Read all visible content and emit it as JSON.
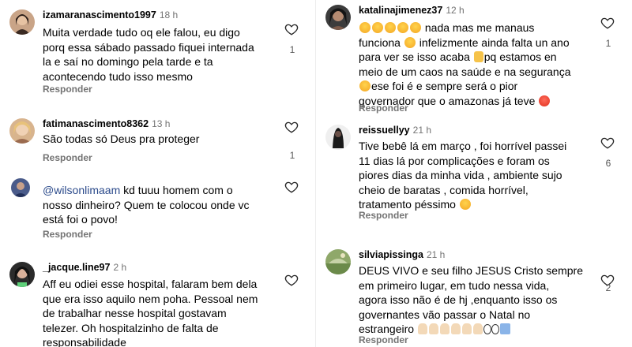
{
  "reply_label": "Responder",
  "left": {
    "c1": {
      "username": "izamaranascimento1997",
      "time": "18 h",
      "lines": [
        "Muita verdade tudo oq ele falou, eu digo",
        "porq essa sábado passado fiquei internada",
        "la e saí no domingo pela tarde e ta",
        "acontecendo tudo isso mesmo"
      ],
      "likes": "1"
    },
    "c2": {
      "username": "fatimanascimento8362",
      "time": "13 h",
      "lines": [
        "São todas só Deus pra proteger"
      ],
      "likes": "1"
    },
    "c3": {
      "mention": "@wilsonlimaam",
      "first_rest": " kd tuuu homem com o",
      "lines": [
        "nosso dinheiro? Quem te colocou onde vc",
        "está foi o povo!"
      ]
    },
    "c4": {
      "username": "_jacque.line97",
      "time": "2 h",
      "lines": [
        "Aff eu odiei esse hospital, falaram bem dela",
        "que era isso aquilo nem poha. Pessoal nem",
        "de trabalhar nesse hospital gostavam",
        "telezer. Oh hospitalzinho de falta de",
        "responsabilidade"
      ]
    }
  },
  "right": {
    "c1": {
      "username": "katalinajimenez37",
      "time": "12 h",
      "line1": "nada mas me manaus",
      "line2a": "funciona",
      "line2b": "infelizmente ainda falta un ano",
      "line3a": "para ver se isso acaba",
      "line3b": "pq estamos en",
      "line4": "meio de um caos na saúde e na segurança",
      "line5": "ese foi é e sempre será o pior",
      "line6": "governador que o amazonas já teve",
      "likes": "1"
    },
    "c2": {
      "username": "reissuellyy",
      "time": "21 h",
      "lines": [
        "Tive bebê lá em março , foi horrível passei",
        "11 dias lá por complicações e foram os",
        "piores dias da minha vida , ambiente sujo",
        "cheio de baratas , comida horrível,"
      ],
      "last": "tratamento péssimo",
      "likes": "6"
    },
    "c3": {
      "username": "silviapissinga",
      "time": "21 h",
      "lines": [
        "DEUS VIVO e seu filho JESUS Cristo sempre",
        "em primeiro lugar, em tudo nessa vida,",
        "agora isso não é de hj ,enquanto isso os",
        "governantes vão passar o Natal no"
      ],
      "last": "estrangeiro",
      "likes": "2"
    }
  },
  "icons": {
    "like": "heart-outline-icon"
  }
}
